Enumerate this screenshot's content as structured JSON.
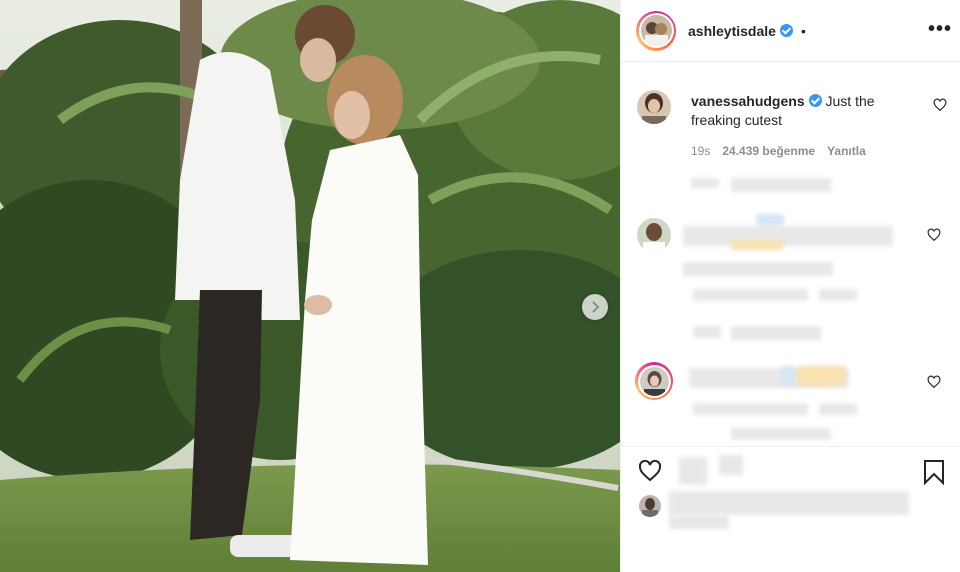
{
  "post": {
    "author": "ashleytisdale",
    "separator": "•",
    "more_label": "•••"
  },
  "comment": {
    "username": "vanessahudgens",
    "text": "Just the freaking cutest",
    "time": "19s",
    "likes": "24.439 beğenme",
    "reply_label": "Yanıtla"
  },
  "icons": {
    "verified": "verified-badge-icon",
    "next": "chevron-right-icon",
    "like": "heart-icon",
    "save": "bookmark-icon"
  },
  "colors": {
    "verified": "#3897f0",
    "muted": "#8e8e8e",
    "text": "#262626"
  }
}
